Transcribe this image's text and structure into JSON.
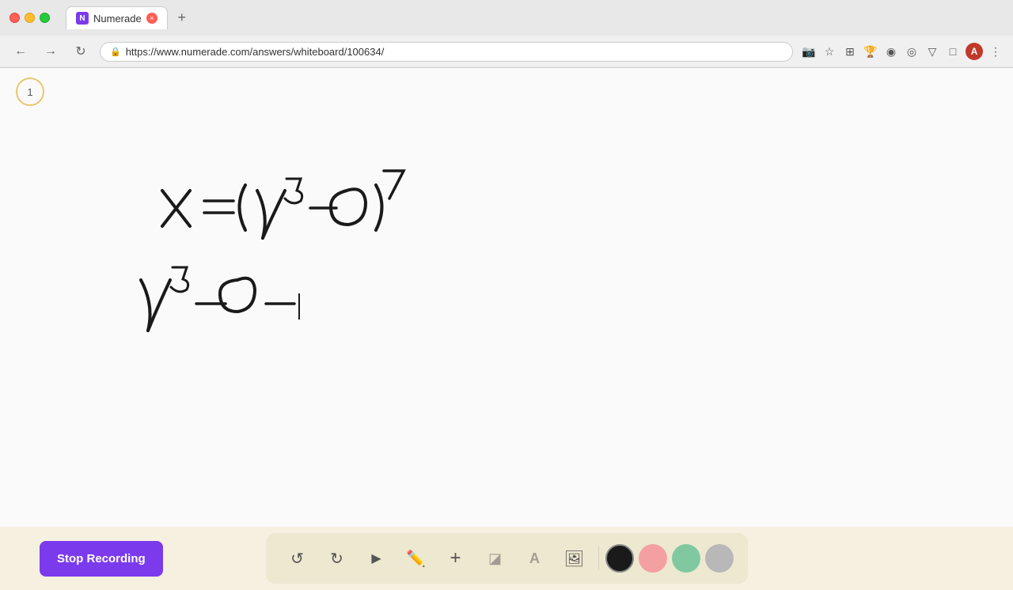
{
  "browser": {
    "tab_title": "Numerade",
    "url": "https://www.numerade.com/answers/whiteboard/100634/",
    "new_tab_label": "+"
  },
  "page": {
    "page_number": "1"
  },
  "toolbar": {
    "stop_recording_label": "Stop Recording",
    "tools": [
      {
        "name": "undo",
        "icon": "↺",
        "label": "Undo"
      },
      {
        "name": "redo",
        "icon": "↻",
        "label": "Redo"
      },
      {
        "name": "select",
        "icon": "▲",
        "label": "Select"
      },
      {
        "name": "pen",
        "icon": "✏",
        "label": "Pen"
      },
      {
        "name": "add",
        "icon": "+",
        "label": "Add"
      },
      {
        "name": "crop",
        "icon": "◪",
        "label": "Crop"
      },
      {
        "name": "text",
        "icon": "A",
        "label": "Text"
      },
      {
        "name": "image",
        "icon": "🖼",
        "label": "Image"
      }
    ],
    "colors": [
      {
        "name": "black",
        "value": "#1a1a1a"
      },
      {
        "name": "pink",
        "value": "#f4a0a0"
      },
      {
        "name": "green",
        "value": "#80c8a0"
      },
      {
        "name": "gray",
        "value": "#b8b8b8"
      }
    ]
  }
}
